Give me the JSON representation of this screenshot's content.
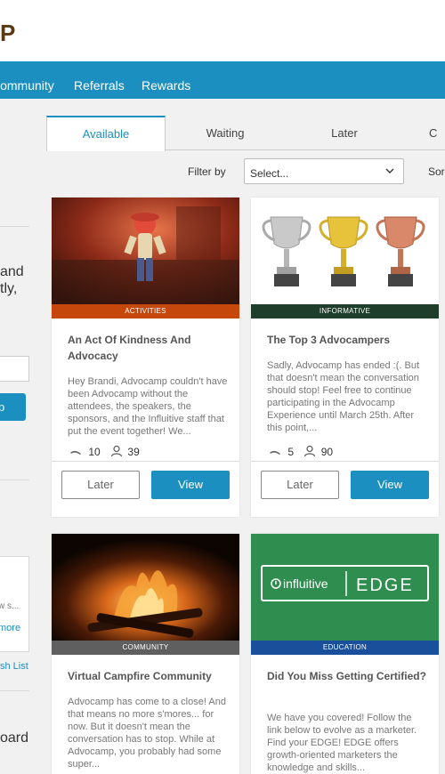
{
  "header": {
    "logo_letter": "P"
  },
  "nav": {
    "items": [
      "Community",
      "Referrals",
      "Rewards"
    ]
  },
  "sidebar": {
    "text_1": "and",
    "text_2": "tly,",
    "button_label": "p",
    "card_text": "w s...",
    "card_link": "more",
    "list_link": "sh List",
    "bottom_text": "oard"
  },
  "tabs": [
    "Available",
    "Waiting",
    "Later",
    "C"
  ],
  "filter": {
    "label": "Filter by",
    "selected": "Select...",
    "sort_label": "Sor"
  },
  "cards": [
    {
      "category": "ACTIVITIES",
      "category_color": "#c5470c",
      "title": "An Act Of Kindness And Advocacy",
      "desc": "Hey Brandi, Advocamp couldn't have been Advocamp without the attendees, the speakers, the sponsors, and the Influitive staff that put the event together! We...",
      "points": "10",
      "participants": "39",
      "later_label": "Later",
      "view_label": "View"
    },
    {
      "category": "INFORMATIVE",
      "category_color": "#1e3d2a",
      "title": "The Top 3 Advocampers",
      "desc": "Sadly, Advocamp has ended :(. But that doesn't mean the conversation should stop! Feel free to continue participating in the Advocamp Experience until March 25th. After this point,...",
      "points": "5",
      "participants": "90",
      "later_label": "Later",
      "view_label": "View"
    },
    {
      "category": "COMMUNITY",
      "category_color": "#5f5f5f",
      "title": "Virtual Campfire Community",
      "desc": "Advocamp has come to a close! And that means no more s'mores... for now. But it doesn't mean the conversation has to stop. While at Advocamp, you probably had some super..."
    },
    {
      "category": "EDUCATION",
      "category_color": "#1a4f9c",
      "title": "Did You Miss Getting Certified?",
      "desc": "We have you covered! Follow the link below to evolve as a marketer. Find your EDGE! EDGE offers growth-oriented marketers the knowledge and skills...",
      "image_logo_text": "influitive",
      "image_edge_text": "EDGE"
    }
  ],
  "colors": {
    "accent": "#1c8fc1",
    "brand": "#5a3a14"
  }
}
